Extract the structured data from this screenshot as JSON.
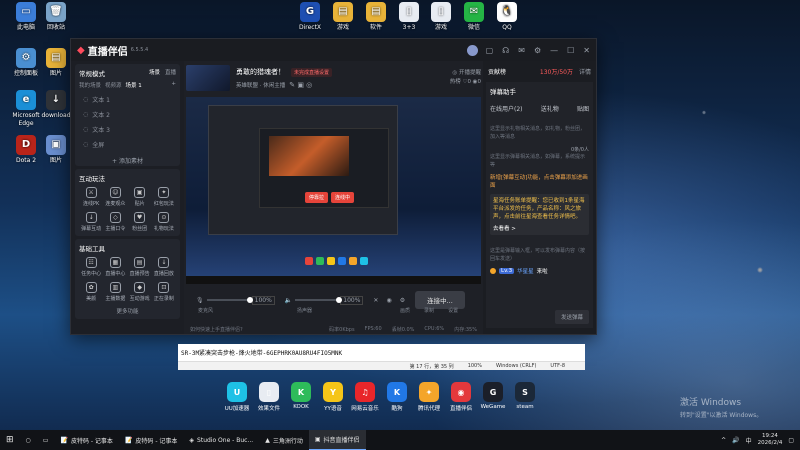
{
  "desktop": {
    "icons": [
      {
        "label": "此电脑",
        "color": "#3b7dd8",
        "glyph": "▭"
      },
      {
        "label": "回收站",
        "color": "#7aa3c8",
        "glyph": "🗑"
      },
      {
        "label": "控制面板",
        "color": "#4a8fd1",
        "glyph": "⚙"
      },
      {
        "label": "图片",
        "color": "#e8b339",
        "glyph": "▤"
      },
      {
        "label": "Microsoft Edge",
        "color": "#1b8fd6",
        "glyph": "e"
      },
      {
        "label": "download",
        "color": "#2f3339",
        "glyph": "↓"
      },
      {
        "label": "Dota 2",
        "color": "#b8241a",
        "glyph": "D"
      },
      {
        "label": "图片",
        "color": "#6a8fd0",
        "glyph": "▣"
      },
      {
        "label": "DirectX",
        "color": "#1e4fb2",
        "glyph": "G"
      },
      {
        "label": "游戏",
        "color": "#e8b339",
        "glyph": "▤"
      },
      {
        "label": "软件",
        "color": "#e8b339",
        "glyph": "▤"
      },
      {
        "label": "3+3",
        "color": "#e8ecf2",
        "glyph": "▯"
      },
      {
        "label": "游戏",
        "color": "#e8ecf2",
        "glyph": "▯"
      },
      {
        "label": "微信",
        "color": "#25b545",
        "glyph": "✉"
      },
      {
        "label": "QQ",
        "color": "#fff",
        "glyph": "🐧"
      }
    ],
    "watermark_title": "激活 Windows",
    "watermark_sub": "转到\"设置\"以激活 Windows。"
  },
  "app": {
    "name": "直播伴侣",
    "version": "6.5.5.4",
    "stream_title": "勇敢的猎魂者！",
    "stream_tag": "未完成直播设置",
    "stream_cat": "英雄联盟 · 休闲主播",
    "stream_actions": [
      "开播提醒",
      "热榜",
      "0",
      "0"
    ],
    "mode_label": "常规模式",
    "mode_tabs": [
      "场景",
      "直播"
    ],
    "scene_tabs": [
      "我的场景",
      "视频源",
      "场景 1"
    ],
    "scene_items": [
      "文本 1",
      "文本 2",
      "文本 3",
      "全屏"
    ],
    "add_material": "+ 添加素材",
    "interact_title": "互动玩法",
    "interact_items": [
      "连线PK",
      "连麦观众",
      "贴片",
      "红包玩法",
      "弹幕互动",
      "主播口令",
      "粉丝团",
      "礼物玩法"
    ],
    "tools_title": "基础工具",
    "tools_items": [
      "任务中心",
      "直播中心",
      "直播预告",
      "直播回放",
      "美颜",
      "主播数据",
      "互动游戏",
      "正在录制"
    ],
    "more_label": "更多功能",
    "footer_hint": "如何快速上手直播伴侣?",
    "preview_popup": [
      "停靠拉",
      "连线中"
    ],
    "mic_label": "麦克风",
    "mic_level": "100%",
    "speaker_label": "扬声器",
    "speaker_level": "100%",
    "bottom_icons": [
      "画质",
      "录制",
      "设置"
    ],
    "start_button": "连接中...",
    "status_bar": [
      "码率0Kbps",
      "FPS:60",
      "丢帧0.0%",
      "CPU:6%",
      "内存:35%"
    ],
    "right": {
      "title": "贡献榜",
      "badge": "130万/50万",
      "badge2": "详情",
      "assistant": "弹幕助手",
      "assistant_tabs": [
        "在线用户(2)",
        "送礼物",
        "贴图"
      ],
      "hint1": "这里显示礼物相关消息，如礼物，粉丝团，加入等消息",
      "hint2": "这里显示弹幕相关消息，如弹幕，系统提示等",
      "counter": "0条/0人",
      "notice": "新增[弹幕互动]功能，点击弹幕添加进画面",
      "notice2": "星海任务账单提醒：您已收到1条星海平台派发的任务，产品名称：风之旅声，点击前往星海查看任务详情吧。",
      "notice_btn": "去看看 >",
      "input_hint": "这里是弹幕输入框，可以发布弹幕内容（按回车发送）",
      "user_name": "华星星",
      "user_badge": "Lv.3",
      "user_msg": "来啦",
      "send": "发送弹幕"
    }
  },
  "notepad": {
    "text": "SR-3M紧凑突击步枪-烽火地带-6GEPHRK0AU8RU4FIO5MNK",
    "status": [
      "第 17 行，第 35 列",
      "100%",
      "Windows (CRLF)",
      "UTF-8"
    ]
  },
  "dock": [
    {
      "label": "UU加速器",
      "color": "#1ec1e6",
      "glyph": "U"
    },
    {
      "label": "效果文件",
      "color": "#e8ecf2",
      "glyph": "▯"
    },
    {
      "label": "KOOK",
      "color": "#2ebb5a",
      "glyph": "K"
    },
    {
      "label": "YY语音",
      "color": "#f5c518",
      "glyph": "Y"
    },
    {
      "label": "网易云音乐",
      "color": "#e8262a",
      "glyph": "♫"
    },
    {
      "label": "酷狗",
      "color": "#2178e6",
      "glyph": "K"
    },
    {
      "label": "腾讯代理",
      "color": "#f4a52a",
      "glyph": "✦"
    },
    {
      "label": "直播伴侣",
      "color": "#e4383c",
      "glyph": "◉"
    },
    {
      "label": "WeGame",
      "color": "#1b1f29",
      "glyph": "G"
    },
    {
      "label": "steam",
      "color": "#1b2838",
      "glyph": "S"
    }
  ],
  "taskbar": {
    "items": [
      "皮特码 - 记事本",
      "皮特码 - 记事本",
      "Studio One - Buc...",
      "三角洲行动",
      "抖音直播伴侣"
    ],
    "tray": [
      "^",
      "🔊",
      "中"
    ],
    "time": "19:24",
    "date": "2026/2/4"
  }
}
